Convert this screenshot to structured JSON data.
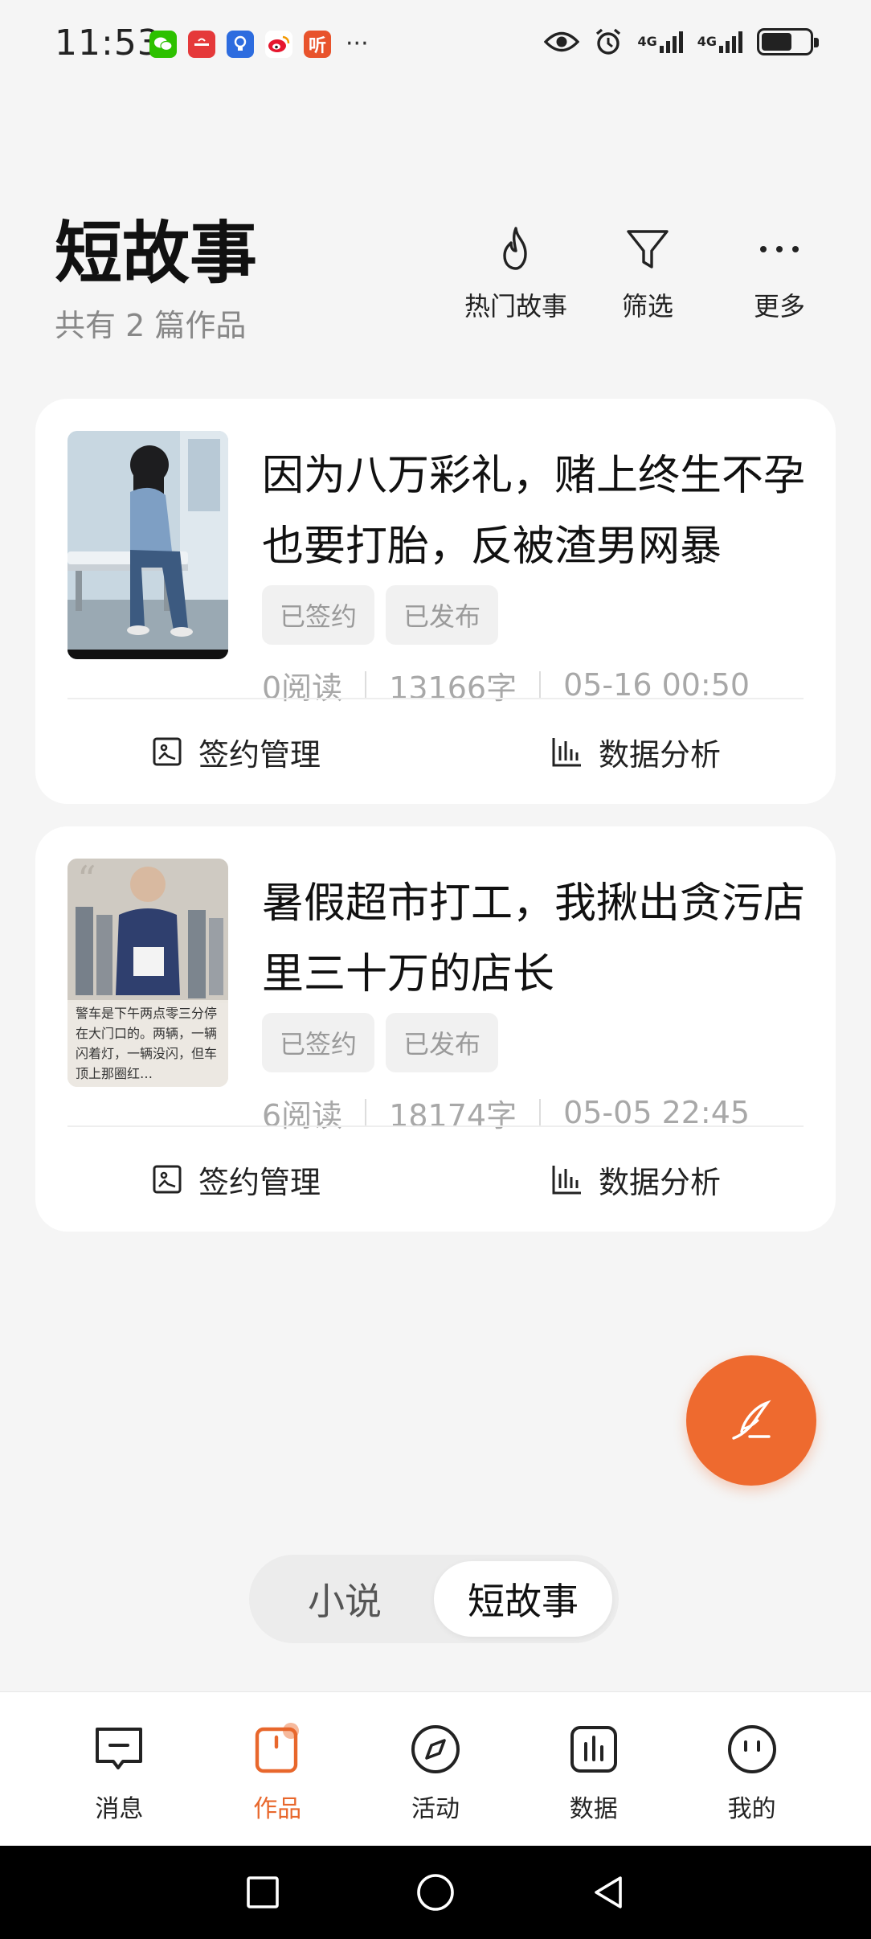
{
  "status_bar": {
    "time": "11:53",
    "notification_icons": [
      {
        "name": "wechat-icon",
        "color": "#2dc100",
        "glyph": "✉"
      },
      {
        "name": "huawei-icon",
        "color": "#e5393a",
        "glyph": "▣"
      },
      {
        "name": "bulb-icon",
        "color": "#2d6cdf",
        "glyph": "◉"
      },
      {
        "name": "weibo-icon",
        "color": "#f5b400",
        "glyph": "◕"
      },
      {
        "name": "listen-app-icon",
        "color": "#e8532c",
        "glyph": "听"
      }
    ],
    "overflow": "···",
    "network_1": "4G",
    "network_2": "4G"
  },
  "header": {
    "title": "短故事",
    "subtitle": "共有 2 篇作品",
    "actions": [
      {
        "label": "热门故事",
        "icon": "flame-icon"
      },
      {
        "label": "筛选",
        "icon": "filter-icon"
      },
      {
        "label": "更多",
        "icon": "more-icon"
      }
    ]
  },
  "stories": [
    {
      "title": "因为八万彩礼，赌上终生不孕也要打胎，反被渣男网暴",
      "tags": [
        "已签约",
        "已发布"
      ],
      "reads": "0阅读",
      "words": "13166字",
      "date": "05-16 00:50",
      "actions": {
        "contract": "签约管理",
        "analytics": "数据分析"
      }
    },
    {
      "title": "暑假超市打工，我揪出贪污店里三十万的店长",
      "cover_text": "警车是下午两点零三分停在大门口的。两辆，一辆闪着灯，一辆没闪，但车顶上那圈红…",
      "tags": [
        "已签约",
        "已发布"
      ],
      "reads": "6阅读",
      "words": "18174字",
      "date": "05-05 22:45",
      "actions": {
        "contract": "签约管理",
        "analytics": "数据分析"
      }
    }
  ],
  "segment": {
    "options": [
      "小说",
      "短故事"
    ],
    "selected": "短故事"
  },
  "bottom_nav": [
    {
      "label": "消息",
      "icon": "message-icon"
    },
    {
      "label": "作品",
      "icon": "works-icon",
      "active": true
    },
    {
      "label": "活动",
      "icon": "compass-icon"
    },
    {
      "label": "数据",
      "icon": "chart-icon"
    },
    {
      "label": "我的",
      "icon": "profile-icon"
    }
  ],
  "colors": {
    "accent": "#ee6a2f",
    "background": "#f5f5f5",
    "card": "#ffffff"
  }
}
